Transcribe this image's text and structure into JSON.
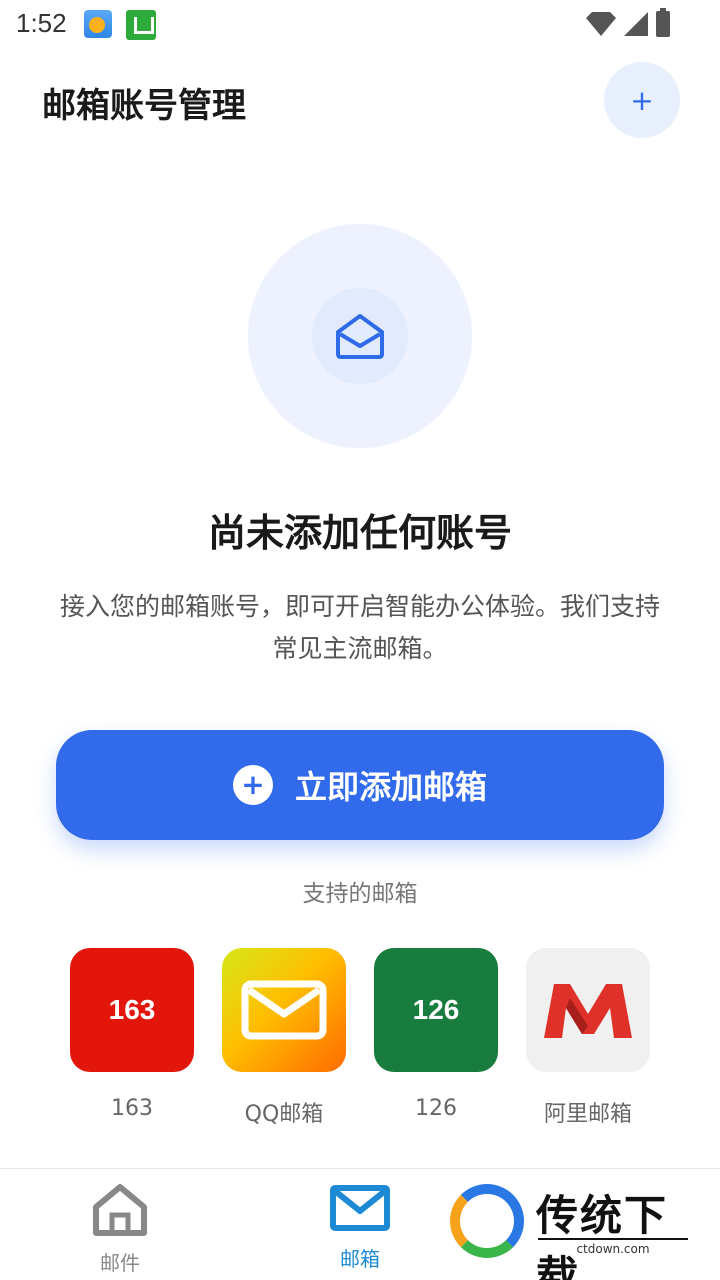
{
  "status_bar": {
    "time": "1:52"
  },
  "header": {
    "title": "邮箱账号管理",
    "add_icon": "plus-icon"
  },
  "empty_state": {
    "icon": "mail-open-icon",
    "title": "尚未添加任何账号",
    "description": "接入您的邮箱账号，即可开启智能办公体验。我们支持常见主流邮箱。"
  },
  "add_button": {
    "label": "立即添加邮箱"
  },
  "supported": {
    "title": "支持的邮箱",
    "providers": [
      {
        "tile_text": "163",
        "name": "163",
        "color": "#e3160b"
      },
      {
        "tile_text": "",
        "name": "QQ邮箱",
        "color": "#ffbe00"
      },
      {
        "tile_text": "126",
        "name": "126",
        "color": "#177c3d"
      },
      {
        "tile_text": "",
        "name": "阿里邮箱",
        "color": "#f0f0f0"
      }
    ]
  },
  "bottom_nav": {
    "items": [
      {
        "label": "邮件",
        "icon": "home-icon",
        "active": false
      },
      {
        "label": "邮箱",
        "icon": "mail-icon",
        "active": true
      }
    ]
  },
  "watermark": {
    "brand": "传统下载",
    "url": "ctdown.com"
  },
  "colors": {
    "accent": "#316bec",
    "active_nav": "#1e8ad6"
  }
}
